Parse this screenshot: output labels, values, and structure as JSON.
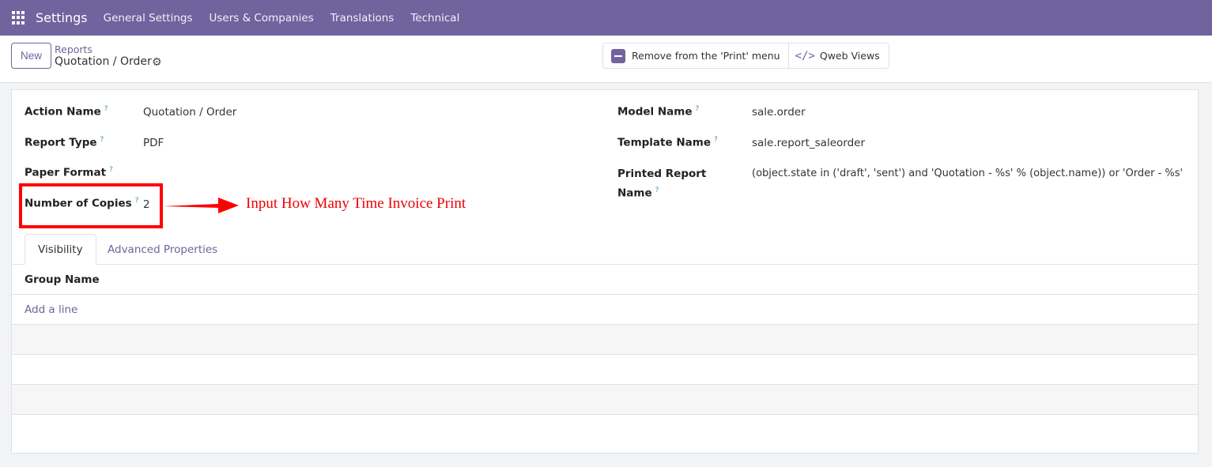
{
  "navbar": {
    "app": "Settings",
    "menus": [
      "General Settings",
      "Users & Companies",
      "Translations",
      "Technical"
    ],
    "color": "#71639e"
  },
  "control_panel": {
    "new_label": "New",
    "breadcrumb_parent": "Reports",
    "breadcrumb_current": "Quotation / Order",
    "actions": {
      "remove": "Remove from the 'Print' menu",
      "qweb": "Qweb Views"
    }
  },
  "form": {
    "left": [
      {
        "label": "Action Name",
        "value": "Quotation / Order"
      },
      {
        "label": "Report Type",
        "value": "PDF"
      },
      {
        "label": "Paper Format",
        "value": ""
      },
      {
        "label": "Number of Copies",
        "value": "2"
      }
    ],
    "right": [
      {
        "label": "Model Name",
        "value": "sale.order"
      },
      {
        "label": "Template Name",
        "value": "sale.report_saleorder"
      },
      {
        "label": "Printed Report Name",
        "value": "(object.state in ('draft', 'sent') and 'Quotation - %s' % (object.name)) or 'Order - %s'"
      }
    ],
    "help_mark": "?",
    "tabs": [
      "Visibility",
      "Advanced Properties"
    ],
    "table": {
      "header": "Group Name",
      "add_line": "Add a line"
    }
  },
  "annotation": {
    "text": "Input How Many Time Invoice Print",
    "color": "#ff0000"
  }
}
